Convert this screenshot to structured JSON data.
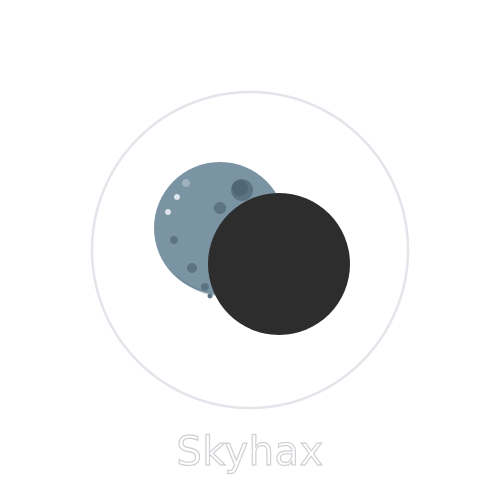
{
  "app": {
    "name": "Skyhax"
  },
  "logo": {
    "icon": "eclipse-moon-icon",
    "ring_color": "#e6e3ea",
    "moon_color": "#7a94a3",
    "moon_crater_color": "#5c7482",
    "shadow_disc_color": "#2d2d2d"
  }
}
